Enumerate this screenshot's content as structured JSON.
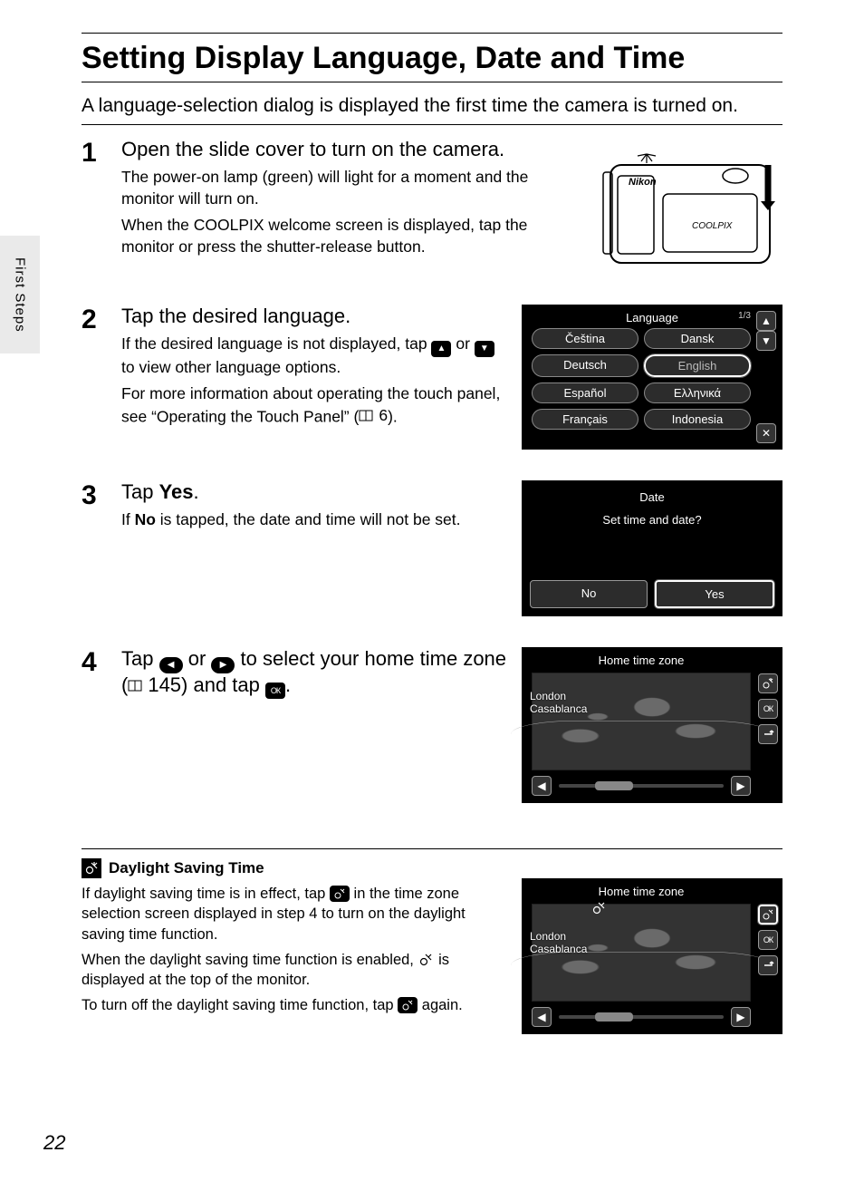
{
  "sideTab": "First Steps",
  "pageNumber": "22",
  "title": "Setting Display Language, Date and Time",
  "intro": "A language-selection dialog is displayed the first time the camera is turned on.",
  "step1": {
    "num": "1",
    "title": "Open the slide cover to turn on the camera.",
    "p1": "The power-on lamp (green) will light for a moment and the monitor will turn on.",
    "p2": "When the COOLPIX welcome screen is displayed, tap the monitor or press the shutter-release button."
  },
  "step2": {
    "num": "2",
    "title": "Tap the desired language.",
    "p1a": "If the desired language is not displayed, tap",
    "p1b": "or",
    "p1c": "to view other language options.",
    "p2a": "For more information about operating the touch panel, see “Operating the Touch Panel” (",
    "p2page": "6",
    "p2b": ")."
  },
  "langScreen": {
    "header": "Language",
    "page": "1/3",
    "items": [
      "Čeština",
      "Dansk",
      "Deutsch",
      "English",
      "Español",
      "Ελληνικά",
      "Français",
      "Indonesia"
    ],
    "selectedIndex": 3
  },
  "step3": {
    "num": "3",
    "titlePre": "Tap ",
    "titleBold": "Yes",
    "titlePost": ".",
    "p1a": "If ",
    "p1bold": "No",
    "p1b": " is tapped, the date and time will not be set."
  },
  "dateScreen": {
    "title": "Date",
    "question": "Set time and date?",
    "no": "No",
    "yes": "Yes"
  },
  "step4": {
    "num": "4",
    "t1": "Tap",
    "t2": "or",
    "t3": "to select your home time zone (",
    "page": "145",
    "t4": ") and tap",
    "t5": "."
  },
  "tzScreen": {
    "title": "Home time zone",
    "city1": "London",
    "city2": "Casablanca",
    "ok": "ОК"
  },
  "note": {
    "heading": "Daylight Saving Time",
    "p1a": "If daylight saving time is in effect, tap",
    "p1b": "in the time zone selection screen displayed in step 4 to turn on the daylight saving time function.",
    "p2a": "When the daylight saving time function is enabled,",
    "p2b": "is displayed at the top of the monitor.",
    "p3a": "To turn off the daylight saving time function, tap",
    "p3b": "again."
  },
  "cameraBrand": "Nikon",
  "cameraLine": "COOLPIX"
}
